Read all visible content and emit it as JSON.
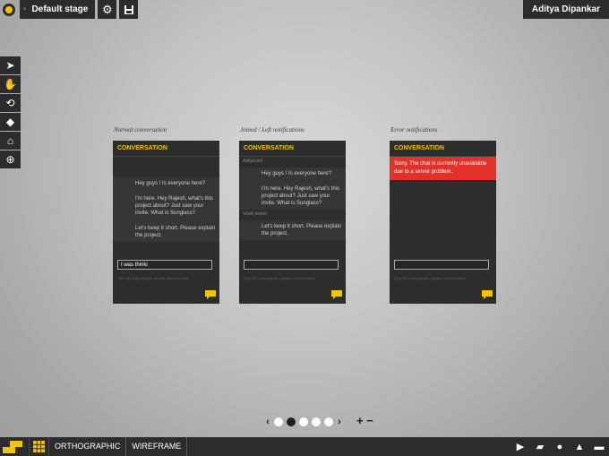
{
  "header": {
    "stage_label": "Default stage",
    "user_name": "Aditya Dipankar"
  },
  "captions": {
    "normal": "Normal conversation",
    "joined": "Joined / Left notifications",
    "error": "Error notifications"
  },
  "panels": {
    "normal": {
      "title": "CONVERSATION",
      "messages": [
        "Hey guys ! Is everyone here?",
        "I'm here. Hey Rajesh, what's this project about? Just saw your invite. What is Sunglass?",
        "Let's keep it short. Please explain the project."
      ],
      "input_value": "I was thinki"
    },
    "joined": {
      "title": "CONVERSATION",
      "note_left": "Aditya left",
      "messages": [
        "Hey guys ! Is everyone here?",
        "I'm here. Hey Rajesh, what's this project about? Just saw your invite. What is Sunglass?"
      ],
      "note_joined": "Vivek joined",
      "messages2": [
        "Let's keep it short. Please explain the project."
      ]
    },
    "error": {
      "title": "CONVERSATION",
      "error_text": "Sorry. The chat is currently unavailable due to a server problem."
    },
    "hint_text": "Type @ to tag objects, people, camera views"
  },
  "pager": {
    "pages": 5,
    "active": 2
  },
  "bottombar": {
    "view_mode": "ORTHOGRAPHIC",
    "render_mode": "WIREFRAME"
  },
  "colors": {
    "accent": "#f5c400",
    "error": "#e0312b",
    "bar": "#2c2c2c"
  }
}
